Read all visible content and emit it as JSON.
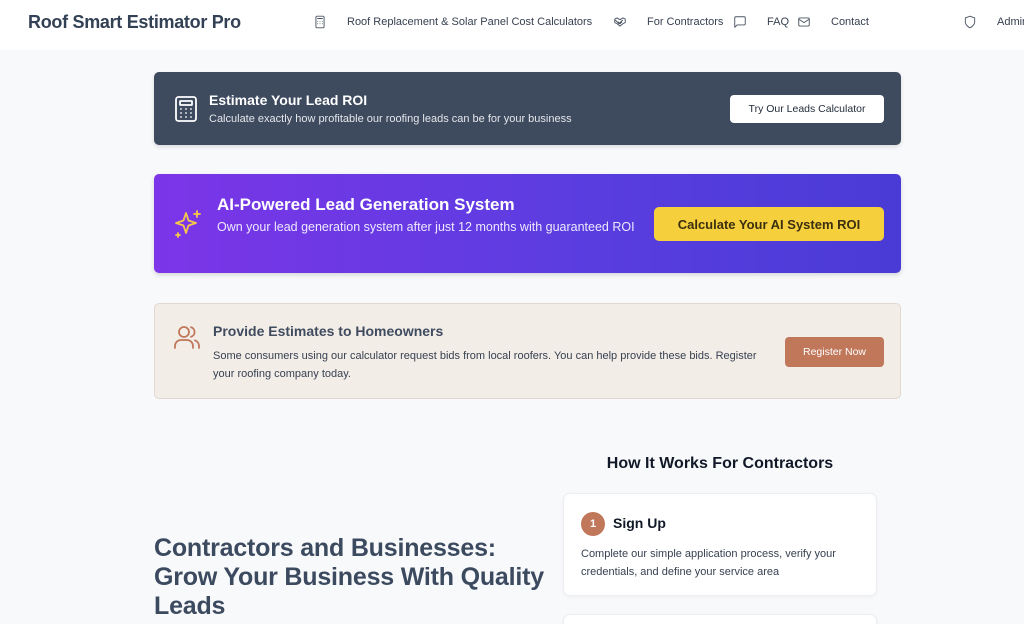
{
  "nav": {
    "brand": "Roof Smart Estimator Pro",
    "items": [
      {
        "label": "Roof Replacement & Solar Panel Cost Calculators",
        "icon": "calculator-icon"
      },
      {
        "label": "For Contractors",
        "icon": "handshake-icon"
      },
      {
        "label": "FAQ",
        "icon": "message-square-icon"
      },
      {
        "label": "Contact",
        "icon": "mail-icon"
      },
      {
        "label": "Admin",
        "icon": "shield-icon"
      }
    ]
  },
  "roi_card": {
    "icon": "calculator-icon",
    "title": "Estimate Your Lead ROI",
    "subtitle": "Calculate exactly how profitable our roofing leads can be for your business",
    "button": "Try Our Leads Calculator",
    "bg_color": "#3e4a5e"
  },
  "ai_card": {
    "icon": "sparkles-icon",
    "title": "AI-Powered Lead Generation System",
    "subtitle": "Own your lead generation system after just 12 months with guaranteed ROI",
    "button": "Calculate Your AI System ROI",
    "accent_color": "#f6cf3c"
  },
  "homeowner_card": {
    "icon": "users-icon",
    "title": "Provide Estimates to Homeowners",
    "subtitle": "Some consumers using our calculator request bids from local roofers. You can help provide these bids. Register your roofing company today.",
    "button": "Register Now",
    "accent_color": "#c0775a"
  },
  "hero": {
    "title": "Contractors and Businesses: Grow Your Business With Quality Leads"
  },
  "how_it_works": {
    "title": "How It Works For Contractors",
    "steps": [
      {
        "number": "1",
        "title": "Sign Up",
        "description": "Complete our simple application process, verify your credentials, and define your service area"
      }
    ]
  }
}
